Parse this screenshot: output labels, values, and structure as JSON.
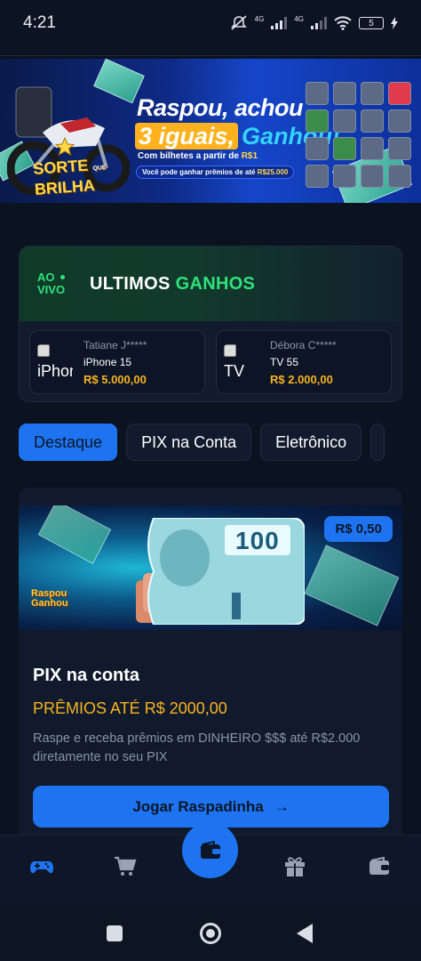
{
  "status_bar": {
    "time": "4:21",
    "network1": "4G",
    "network2": "4G",
    "battery": "5"
  },
  "hero": {
    "logo_line1": "SORTE",
    "logo_line2": "BRILHA",
    "logo_small": "QUE",
    "title_line1": "Raspou, achou",
    "title_highlight": "3 iguais,",
    "title_end": "Ganhou!",
    "subtitle_prefix": "Com bilhetes a partir de ",
    "subtitle_value": "R$1",
    "pill_prefix": "Você pode ganhar prêmios de até ",
    "pill_value": "R$25.000"
  },
  "winners": {
    "live_line1": "AO",
    "live_line2": "VIVO",
    "title": "ULTIMOS",
    "title_highlight": "GANHOS",
    "items": [
      {
        "img_alt": "iPhone",
        "name": "Tatiane J*****",
        "product": "iPhone 15",
        "value": "R$ 5.000,00"
      },
      {
        "img_alt": "TV",
        "name": "Débora C*****",
        "product": "TV 55",
        "value": "R$ 2.000,00"
      }
    ]
  },
  "tabs": [
    {
      "label": "Destaque",
      "active": true
    },
    {
      "label": "PIX na Conta",
      "active": false
    },
    {
      "label": "Eletrônico",
      "active": false
    }
  ],
  "product": {
    "price": "R$ 0,50",
    "brand_line1": "Raspou",
    "brand_line2": "Ganhou",
    "bill_value": "100",
    "title": "PIX na conta",
    "prize": "PRÊMIOS ATÉ R$ 2000,00",
    "description": "Raspe e receba prêmios em DINHEIRO $$$ até R$2.000 diretamente no seu PIX",
    "button_label": "Jogar Raspadinha",
    "button_arrow": "→"
  },
  "bottom_nav": {
    "items": [
      "gamepad-icon",
      "cart-icon",
      "wallet-icon",
      "gift-icon",
      "wallet-icon"
    ],
    "active_color": "#1e74f0",
    "inactive_color": "#9aa3b5"
  },
  "colors": {
    "accent": "#1e74f0",
    "gold": "#f7b41f",
    "green": "#2ee27a",
    "background": "#0b1220"
  }
}
